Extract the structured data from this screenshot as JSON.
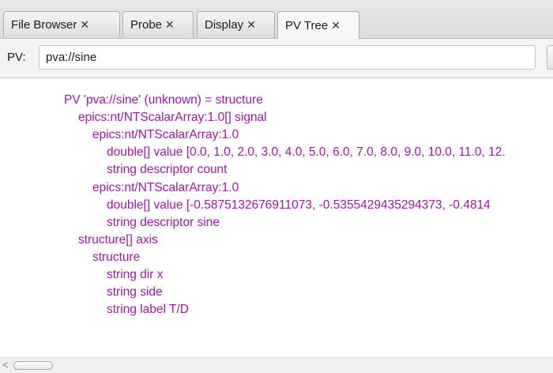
{
  "tabs": [
    {
      "label": "File Browser",
      "close": "✕"
    },
    {
      "label": "Probe",
      "close": "✕"
    },
    {
      "label": "Display",
      "close": "✕"
    },
    {
      "label": "PV Tree",
      "close": "✕"
    }
  ],
  "active_tab": "PV Tree",
  "pv_field": {
    "label": "PV:",
    "value": "pva://sine"
  },
  "tree": {
    "text_color": "#a214a8",
    "lines": [
      {
        "text": "PV 'pva://sine' (unknown)  =  structure",
        "depth": 0
      },
      {
        "text": "epics:nt/NTScalarArray:1.0[] signal",
        "depth": 1
      },
      {
        "text": "epics:nt/NTScalarArray:1.0",
        "depth": 2
      },
      {
        "text": "double[] value [0.0, 1.0, 2.0, 3.0, 4.0, 5.0, 6.0, 7.0, 8.0, 9.0, 10.0, 11.0, 12.",
        "depth": 3
      },
      {
        "text": "string descriptor count",
        "depth": 3
      },
      {
        "text": "epics:nt/NTScalarArray:1.0",
        "depth": 2
      },
      {
        "text": "double[] value [-0.5875132676911073, -0.5355429435294373, -0.4814",
        "depth": 3
      },
      {
        "text": "string descriptor sine",
        "depth": 3
      },
      {
        "text": "structure[] axis",
        "depth": 1
      },
      {
        "text": "structure",
        "depth": 2
      },
      {
        "text": "string dir x",
        "depth": 3
      },
      {
        "text": "string side",
        "depth": 3
      },
      {
        "text": "string label T/D",
        "depth": 3
      }
    ]
  },
  "scrollbar": {
    "left_arrow": "<"
  }
}
